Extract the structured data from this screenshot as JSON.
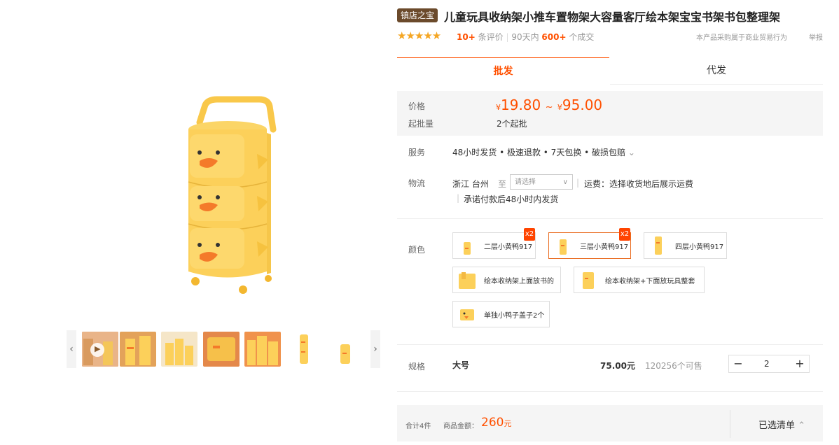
{
  "header": {
    "badge": "镇店之宝",
    "title": "儿童玩具收纳架小推车置物架大容量客厅绘本架宝宝书架书包整理架",
    "stars": "★★★★★",
    "review_count": "10+",
    "review_label": "条评价",
    "divider": "|",
    "sold_prefix": "90天内",
    "sold_count": "600+",
    "sold_suffix": "个成交",
    "trade_note": "本产品采购属于商业贸易行为",
    "report": "举报"
  },
  "tabs": {
    "wholesale": "批发",
    "dropship": "代发"
  },
  "price": {
    "label": "价格",
    "currency": "¥",
    "low": "19.80",
    "tilde": "~",
    "high": "95.00",
    "moq_label": "起批量",
    "moq_value": "2个起批"
  },
  "service": {
    "label": "服务",
    "value": "48小时发货 • 极速退款 • 7天包换 • 破损包赔",
    "chevron": "⌄"
  },
  "logistics": {
    "label": "物流",
    "origin": "浙江 台州",
    "to": "至",
    "select_placeholder": "请选择",
    "select_chevron": "∨",
    "bar": "|",
    "freight": "运费：选择收货地后展示运费",
    "promise": "承诺付款后48小时内发货"
  },
  "color": {
    "label": "颜色",
    "options": [
      {
        "label": "二层小黄鸭917",
        "badge": "x2"
      },
      {
        "label": "三层小黄鸭917",
        "badge": "x2"
      },
      {
        "label": "四层小黄鸭917"
      },
      {
        "label": "绘本收纳架上面放书的"
      },
      {
        "label": "绘本收纳架+下面放玩具整套"
      },
      {
        "label": "单独小鸭子盖子2个"
      }
    ]
  },
  "spec": {
    "label": "规格",
    "name": "大号",
    "price": "75.00元",
    "stock": "120256个可售",
    "minus": "−",
    "qty": "2",
    "plus": "+"
  },
  "footer": {
    "total_count": "合计4件",
    "amount_label": "商品金额：",
    "amount_value": "260",
    "amount_unit": "元",
    "cart_label": "已选清单",
    "cart_chevron": "⌃"
  },
  "gallery": {
    "prev": "‹",
    "next": "›",
    "play": "▶"
  },
  "colors": {
    "accent": "#ff5000",
    "duck_yellow": "#fcd05a",
    "beak": "#f47a2a"
  },
  "icons": [
    "star-icon",
    "play-icon",
    "chevron-left-icon",
    "chevron-right-icon",
    "chevron-down-icon",
    "chevron-up-icon",
    "minus-icon",
    "plus-icon"
  ]
}
